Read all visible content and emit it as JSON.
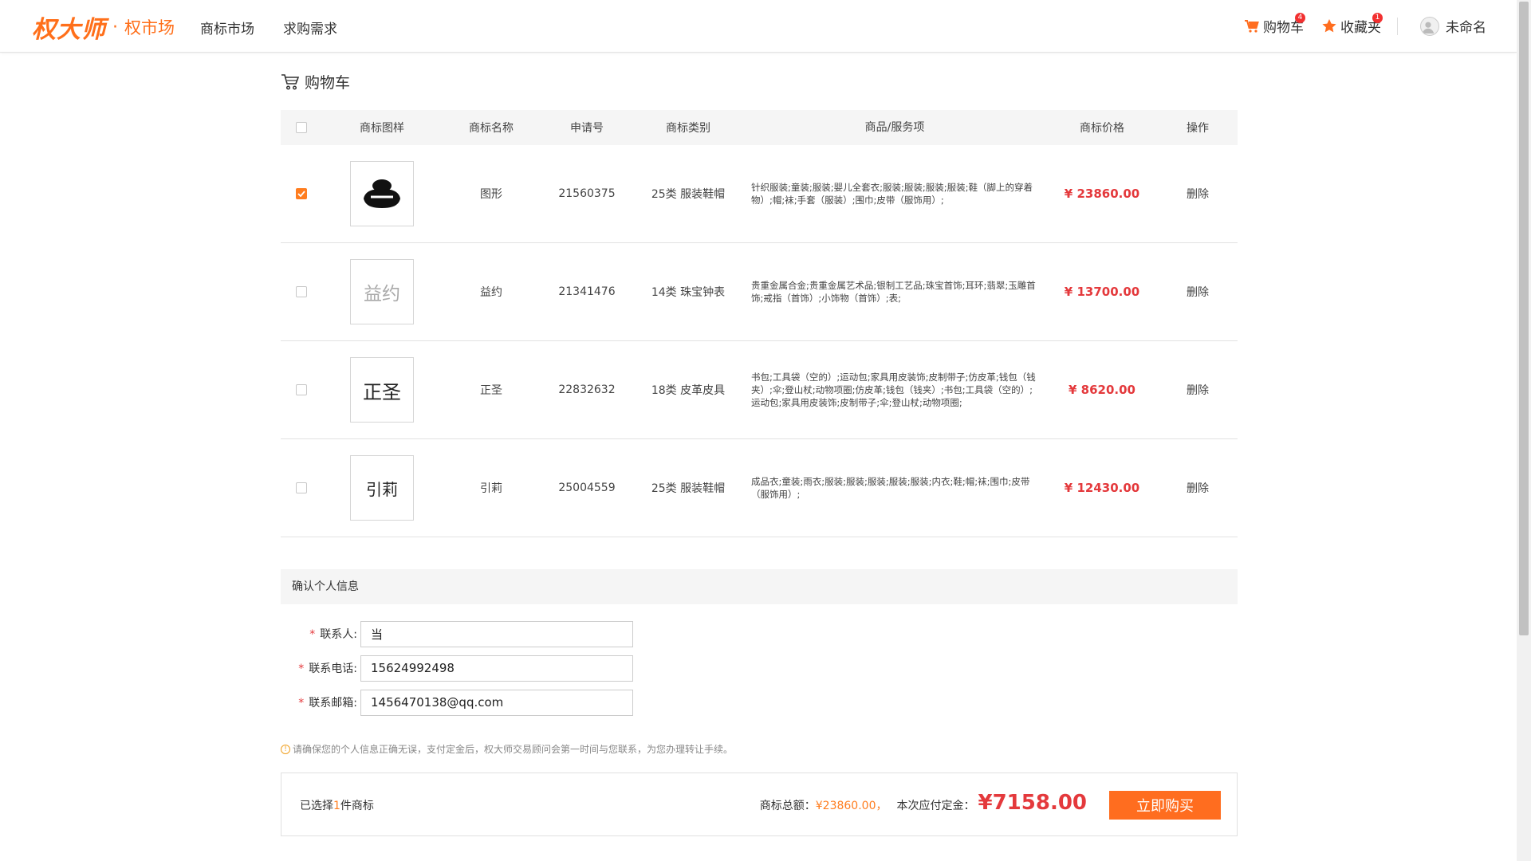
{
  "header": {
    "logo_text": "权大师",
    "logo_dot": "·",
    "sub_brand": "权市场",
    "nav": [
      "商标市场",
      "求购需求"
    ],
    "cart_label": "购物车",
    "cart_badge": "4",
    "fav_label": "收藏夹",
    "fav_badge": "1",
    "user_name": "未命名"
  },
  "page": {
    "title": "购物车"
  },
  "table": {
    "columns": [
      "商标图样",
      "商标名称",
      "申请号",
      "商标类别",
      "商品/服务项",
      "商标价格",
      "操作"
    ],
    "rows": [
      {
        "checked": true,
        "image_text": "",
        "name": "图形",
        "app_no": "21560375",
        "category": "25类 服装鞋帽",
        "goods": "针织服装;童装;服装;婴儿全套衣;服装;服装;服装;服装;鞋（脚上的穿着物）;帽;袜;手套（服装）;围巾;皮带（服饰用）;",
        "price": "¥ 23860.00",
        "op": "删除"
      },
      {
        "checked": false,
        "image_text": "益约",
        "name": "益约",
        "app_no": "21341476",
        "category": "14类 珠宝钟表",
        "goods": "贵重金属合金;贵重金属艺术品;银制工艺品;珠宝首饰;耳环;翡翠;玉雕首饰;戒指（首饰）;小饰物（首饰）;表;",
        "price": "¥ 13700.00",
        "op": "删除"
      },
      {
        "checked": false,
        "image_text": "正圣",
        "name": "正圣",
        "app_no": "22832632",
        "category": "18类 皮革皮具",
        "goods": "书包;工具袋（空的）;运动包;家具用皮装饰;皮制带子;仿皮革;钱包（钱夹）;伞;登山杖;动物项圈;仿皮革;钱包（钱夹）;书包;工具袋（空的）;运动包;家具用皮装饰;皮制带子;伞;登山杖;动物项圈;",
        "price": "¥ 8620.00",
        "op": "删除"
      },
      {
        "checked": false,
        "image_text": "引莉",
        "name": "引莉",
        "app_no": "25004559",
        "category": "25类 服装鞋帽",
        "goods": "成品衣;童装;雨衣;服装;服装;服装;服装;服装;内衣;鞋;帽;袜;围巾;皮带（服饰用）;",
        "price": "¥ 12430.00",
        "op": "删除"
      }
    ]
  },
  "info": {
    "title": "确认个人信息",
    "required_mark": "*",
    "contact_label": "联系人:",
    "contact_value": "当",
    "phone_label": "联系电话:",
    "phone_value": "15624992498",
    "email_label": "联系邮箱:",
    "email_value": "1456470138@qq.com",
    "notice_icon": "!",
    "notice": "请确保您的个人信息正确无误，支付定金后，权大师交易顾问会第一时间与您联系，为您办理转让手续。"
  },
  "summary": {
    "selected_prefix": "已选择",
    "selected_count": "1",
    "selected_suffix": "件商标",
    "total_label": "商标总额：",
    "total_value": "¥23860.00，",
    "deposit_label": "本次应付定金：",
    "deposit_value": "¥7158.00",
    "buy_button": "立即购买"
  },
  "colors": {
    "accent": "#ff6d1f",
    "price_red": "#e4393c"
  }
}
